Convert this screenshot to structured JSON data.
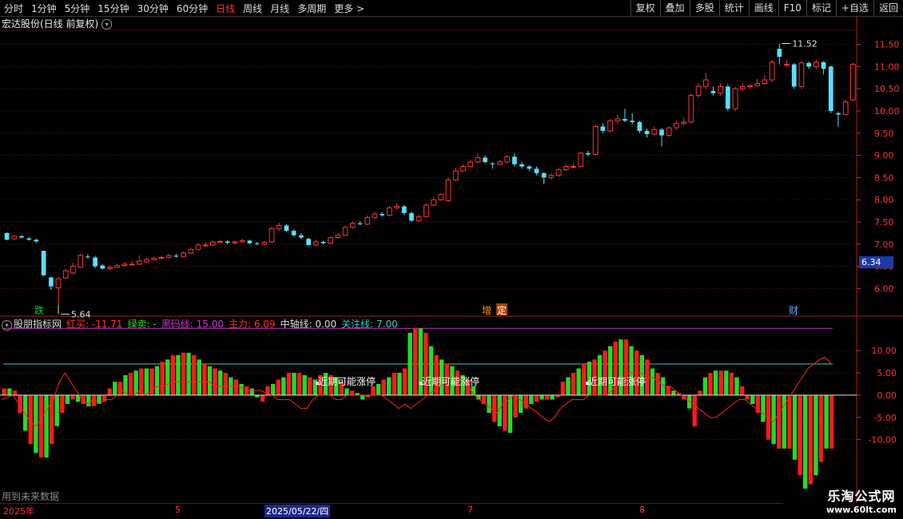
{
  "toolbar": {
    "timeframes": [
      "分时",
      "1分钟",
      "5分钟",
      "15分钟",
      "30分钟",
      "60分钟",
      "日线",
      "周线",
      "月线",
      "多周期",
      "更多 >"
    ],
    "active": "日线",
    "right_buttons": [
      "复权",
      "叠加",
      "多股",
      "统计",
      "画线",
      "F10",
      "标记",
      "+自选",
      "返回"
    ]
  },
  "main": {
    "title": "宏达股份(日线 前复权)",
    "high_label": "11.52",
    "low_label": "5.64",
    "price_tag": "6.34",
    "markers": [
      {
        "text": "跌",
        "color": "#00cc44",
        "bg": ""
      },
      {
        "text": "增",
        "color": "#ff9900",
        "bg": ""
      },
      {
        "text": "定",
        "color": "#ffffff",
        "bg": "#aa4400"
      },
      {
        "text": "财",
        "color": "#66aaff",
        "bg": ""
      }
    ]
  },
  "indicator": {
    "name": "股朋指标网",
    "red_buy": "红买: -11.71",
    "green_sell": "绿卖: -",
    "black_horse": "黑码线: 15.00",
    "main_force": "主力: 6.09",
    "mid_axis": "中轴线: 0.00",
    "focus_line": "关注线: 7.00",
    "annotations": [
      "近期可能涨停",
      "近期可能涨停",
      "近期可能涨停"
    ]
  },
  "footnote": "用到未来数据",
  "logo": {
    "line1": "乐淘公式网",
    "line2": "www.60lt.com"
  },
  "date_axis": {
    "labels": [
      "2025年",
      "5",
      "2025/05/22/四",
      "7",
      "8"
    ]
  },
  "colors": {
    "up": "#ff3333",
    "down": "#54e1ff",
    "ind_up": "#ff1a1a",
    "ind_down": "#22dd22",
    "magenta": "#cc33cc",
    "cyan": "#33cccc"
  },
  "chart_data": [
    {
      "type": "candlestick",
      "y_axis": {
        "ticks": [
          6.0,
          6.5,
          7.0,
          7.5,
          8.0,
          8.5,
          9.0,
          9.5,
          10.0,
          10.5,
          11.0,
          11.5
        ],
        "ylim": [
          5.45,
          11.78
        ]
      },
      "candles": [
        [
          7.25,
          7.1,
          7.27,
          7.09
        ],
        [
          7.12,
          7.18,
          7.2,
          7.1
        ],
        [
          7.18,
          7.15,
          7.2,
          7.13
        ],
        [
          7.13,
          7.1,
          7.16,
          7.08
        ],
        [
          7.1,
          7.06,
          7.12,
          7.04
        ],
        [
          6.85,
          6.3,
          6.85,
          6.28
        ],
        [
          6.25,
          6.05,
          6.27,
          5.97
        ],
        [
          6.02,
          6.22,
          6.26,
          5.64
        ],
        [
          6.24,
          6.4,
          6.44,
          6.22
        ],
        [
          6.35,
          6.5,
          6.58,
          6.33
        ],
        [
          6.48,
          6.75,
          6.78,
          6.46
        ],
        [
          6.72,
          6.7,
          6.78,
          6.68
        ],
        [
          6.7,
          6.5,
          6.74,
          6.46
        ],
        [
          6.52,
          6.45,
          6.55,
          6.43
        ],
        [
          6.45,
          6.48,
          6.52,
          6.42
        ],
        [
          6.48,
          6.52,
          6.56,
          6.46
        ],
        [
          6.52,
          6.55,
          6.6,
          6.5
        ],
        [
          6.55,
          6.55,
          6.62,
          6.52
        ],
        [
          6.55,
          6.62,
          6.75,
          6.53
        ],
        [
          6.6,
          6.65,
          6.7,
          6.58
        ],
        [
          6.65,
          6.68,
          6.72,
          6.63
        ],
        [
          6.68,
          6.7,
          6.74,
          6.66
        ],
        [
          6.7,
          6.74,
          6.78,
          6.68
        ],
        [
          6.74,
          6.72,
          6.78,
          6.7
        ],
        [
          6.72,
          6.8,
          6.84,
          6.7
        ],
        [
          6.8,
          6.88,
          6.92,
          6.78
        ],
        [
          6.88,
          6.98,
          7.02,
          6.86
        ],
        [
          6.98,
          6.98,
          7.05,
          6.94
        ],
        [
          6.98,
          7.05,
          7.08,
          6.96
        ],
        [
          7.05,
          7.06,
          7.1,
          7.03
        ],
        [
          7.06,
          7.03,
          7.09,
          7.0
        ],
        [
          7.03,
          7.05,
          7.08,
          7.0
        ],
        [
          7.05,
          7.08,
          7.12,
          7.03
        ],
        [
          7.08,
          7.02,
          7.1,
          7.0
        ],
        [
          7.02,
          7.0,
          7.05,
          6.98
        ],
        [
          7.0,
          7.04,
          7.07,
          6.98
        ],
        [
          7.05,
          7.35,
          7.4,
          7.03
        ],
        [
          7.35,
          7.42,
          7.48,
          7.3
        ],
        [
          7.42,
          7.3,
          7.45,
          7.28
        ],
        [
          7.3,
          7.2,
          7.33,
          7.18
        ],
        [
          7.2,
          7.15,
          7.25,
          7.12
        ],
        [
          7.12,
          6.98,
          7.15,
          6.95
        ],
        [
          6.98,
          7.05,
          7.1,
          6.95
        ],
        [
          7.05,
          7.02,
          7.08,
          7.0
        ],
        [
          7.02,
          7.15,
          7.18,
          7.0
        ],
        [
          7.15,
          7.2,
          7.25,
          7.13
        ],
        [
          7.2,
          7.38,
          7.42,
          7.18
        ],
        [
          7.38,
          7.47,
          7.52,
          7.35
        ],
        [
          7.47,
          7.45,
          7.52,
          7.43
        ],
        [
          7.45,
          7.6,
          7.65,
          7.43
        ],
        [
          7.6,
          7.68,
          7.73,
          7.57
        ],
        [
          7.68,
          7.65,
          7.72,
          7.62
        ],
        [
          7.65,
          7.82,
          7.87,
          7.62
        ],
        [
          7.82,
          7.85,
          7.92,
          7.78
        ],
        [
          7.85,
          7.7,
          7.88,
          7.65
        ],
        [
          7.7,
          7.53,
          7.73,
          7.5
        ],
        [
          7.53,
          7.62,
          7.66,
          7.5
        ],
        [
          7.62,
          7.88,
          7.92,
          7.6
        ],
        [
          7.88,
          8.0,
          8.06,
          7.85
        ],
        [
          8.0,
          8.12,
          8.15,
          7.98
        ],
        [
          7.98,
          8.45,
          8.5,
          7.95
        ],
        [
          8.45,
          8.65,
          8.72,
          8.42
        ],
        [
          8.65,
          8.75,
          8.8,
          8.62
        ],
        [
          8.75,
          8.85,
          8.9,
          8.72
        ],
        [
          8.85,
          8.95,
          9.05,
          8.82
        ],
        [
          8.95,
          8.85,
          9.0,
          8.82
        ],
        [
          8.82,
          8.8,
          8.85,
          8.7
        ],
        [
          8.8,
          8.85,
          8.9,
          8.78
        ],
        [
          8.85,
          8.97,
          9.0,
          8.82
        ],
        [
          8.97,
          8.8,
          9.05,
          8.75
        ],
        [
          8.8,
          8.75,
          8.85,
          8.7
        ],
        [
          8.75,
          8.7,
          8.78,
          8.65
        ],
        [
          8.7,
          8.6,
          8.75,
          8.55
        ],
        [
          8.6,
          8.5,
          8.62,
          8.35
        ],
        [
          8.5,
          8.55,
          8.6,
          8.45
        ],
        [
          8.55,
          8.68,
          8.72,
          8.52
        ],
        [
          8.68,
          8.75,
          8.8,
          8.65
        ],
        [
          8.75,
          8.75,
          8.82,
          8.7
        ],
        [
          8.75,
          9.05,
          9.08,
          8.72
        ],
        [
          9.05,
          9.02,
          9.1,
          8.98
        ],
        [
          9.02,
          9.65,
          9.7,
          9.0
        ],
        [
          9.65,
          9.55,
          9.72,
          9.5
        ],
        [
          9.55,
          9.78,
          9.82,
          9.52
        ],
        [
          9.78,
          9.82,
          9.92,
          9.7
        ],
        [
          9.82,
          9.78,
          10.05,
          9.75
        ],
        [
          9.78,
          9.75,
          9.95,
          9.7
        ],
        [
          9.75,
          9.55,
          9.78,
          9.5
        ],
        [
          9.55,
          9.48,
          9.6,
          9.4
        ],
        [
          9.48,
          9.58,
          9.65,
          9.45
        ],
        [
          9.58,
          9.45,
          9.62,
          9.2
        ],
        [
          9.45,
          9.62,
          9.65,
          9.42
        ],
        [
          9.62,
          9.72,
          9.78,
          9.58
        ],
        [
          9.72,
          9.75,
          9.85,
          9.68
        ],
        [
          9.75,
          10.35,
          10.4,
          9.72
        ],
        [
          10.35,
          10.55,
          10.62,
          10.3
        ],
        [
          10.55,
          10.7,
          10.85,
          10.5
        ],
        [
          10.45,
          10.4,
          10.55,
          10.35
        ],
        [
          10.4,
          10.55,
          10.62,
          10.35
        ],
        [
          10.55,
          10.05,
          10.6,
          10.0
        ],
        [
          10.05,
          10.5,
          10.55,
          10.0
        ],
        [
          10.5,
          10.55,
          10.62,
          10.45
        ],
        [
          10.55,
          10.57,
          10.6,
          10.5
        ],
        [
          10.57,
          10.62,
          10.72,
          10.55
        ],
        [
          10.62,
          10.7,
          10.8,
          10.58
        ],
        [
          10.7,
          11.1,
          11.15,
          10.65
        ],
        [
          11.4,
          11.22,
          11.52,
          11.05
        ],
        [
          11.05,
          11.05,
          11.15,
          10.98
        ],
        [
          11.05,
          10.55,
          11.08,
          10.5
        ],
        [
          10.55,
          11.08,
          11.12,
          10.5
        ],
        [
          11.08,
          11.0,
          11.12,
          10.95
        ],
        [
          11.0,
          11.1,
          11.15,
          10.95
        ],
        [
          11.1,
          10.95,
          11.12,
          10.82
        ],
        [
          11.0,
          10.0,
          11.02,
          9.95
        ],
        [
          9.95,
          9.92,
          9.98,
          9.65
        ],
        [
          9.92,
          10.2,
          10.25,
          9.9
        ],
        [
          10.25,
          11.05,
          11.08,
          10.22
        ]
      ]
    },
    {
      "type": "bar",
      "y_axis": {
        "ticks": [
          10.0,
          5.0,
          0.0,
          -5.0,
          -10.0
        ],
        "ylim": [
          -21.0,
          14.5
        ]
      },
      "reference_lines": {
        "black_horse": 15.0,
        "focus": 7.0,
        "mid": 0.0
      },
      "bars": [
        1.5,
        1.5,
        1.0,
        -4,
        -8,
        -11,
        -13,
        -14,
        -14,
        -11,
        -7,
        -4,
        -2,
        -1,
        -1.5,
        -2,
        -2.5,
        -2.5,
        -2,
        -1.5,
        1.5,
        3,
        3,
        4.5,
        5,
        5.5,
        6,
        6,
        6,
        6.5,
        7.5,
        8,
        9,
        9,
        9.5,
        9.5,
        9,
        8,
        7,
        6.5,
        6,
        5.5,
        5,
        4,
        3.5,
        2.5,
        2,
        1.5,
        -0.5,
        -1.5,
        2,
        2.5,
        3.5,
        4,
        5,
        5,
        5,
        4.5,
        4,
        3.5,
        4.5,
        5,
        4.5,
        4,
        3,
        1.5,
        1,
        0.5,
        -1,
        -0.5,
        2,
        2.5,
        3.5,
        4,
        5,
        5,
        6,
        14,
        15,
        15,
        14,
        11,
        9,
        8,
        7,
        6.5,
        5.5,
        4.5,
        3.5,
        2,
        -1,
        -2,
        -4,
        -6,
        -7,
        -8,
        -8.5,
        -5,
        -4,
        -3,
        -2,
        -1.5,
        -1,
        -1,
        -1,
        -0.5,
        3,
        4,
        5,
        6,
        7,
        7.5,
        8,
        9,
        10,
        11,
        12,
        12.5,
        12.5,
        11,
        10,
        9,
        8,
        6,
        5,
        4,
        2,
        1,
        0.5,
        -1,
        -3,
        -7,
        1,
        4,
        5,
        5.5,
        5.5,
        5.5,
        5,
        4,
        2,
        -1,
        -2,
        -4,
        -6,
        -10,
        -11,
        -12,
        -12,
        -12,
        -14.5,
        -18,
        -21,
        -20,
        -18,
        -15,
        -12,
        -12
      ],
      "line": [
        -1,
        -0.5,
        0,
        -2,
        -4,
        -6,
        -7,
        -5,
        -3,
        -1,
        3,
        5,
        3,
        1,
        -1,
        -2,
        -1,
        -2,
        -1,
        -1,
        0,
        1,
        0,
        0,
        1,
        0,
        1,
        2,
        2,
        2.5,
        3,
        3,
        3,
        3,
        3,
        3,
        3,
        2,
        2,
        2,
        2,
        2,
        1.5,
        1,
        1,
        1,
        0.5,
        0,
        -1,
        -1,
        -1,
        -2,
        -3,
        -3,
        -1,
        0,
        0,
        0,
        -1,
        -1,
        0,
        0,
        0,
        0,
        0,
        0,
        0,
        -1,
        -2,
        -3,
        -2,
        -3,
        -2,
        -1,
        0,
        1,
        2,
        3,
        4,
        4,
        3.5,
        2,
        0,
        -1,
        -2,
        -3,
        -4,
        -2,
        -1,
        0,
        -1,
        -2,
        -3,
        -4,
        -5,
        -6,
        -5,
        -3,
        -2,
        -1,
        -1,
        -1,
        0,
        0,
        0,
        0,
        1,
        3,
        4,
        5,
        5,
        5,
        4,
        4,
        3,
        2,
        2,
        1,
        0,
        -1,
        -2,
        -3,
        -4,
        -5,
        -5,
        -4,
        -3,
        -2,
        -1,
        -1,
        -2,
        -3,
        -4,
        -5,
        -6,
        -4,
        -2,
        0,
        2,
        4,
        6,
        7,
        8,
        8.5,
        7
      ]
    }
  ]
}
